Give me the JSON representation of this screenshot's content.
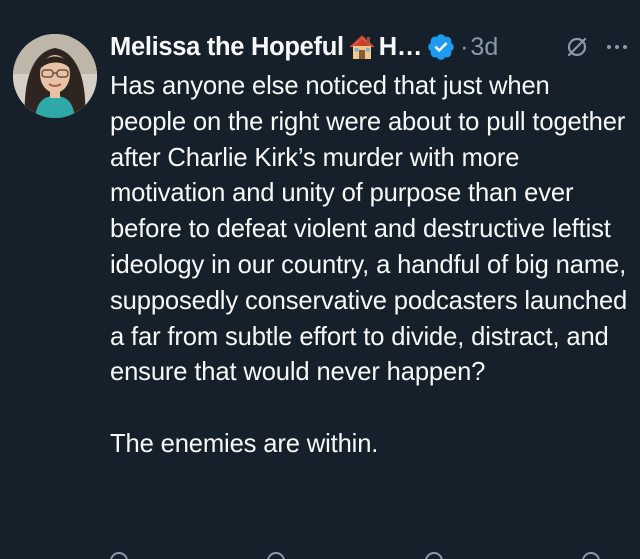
{
  "post": {
    "author": {
      "display_name": "Melissa the Hopeful",
      "name_truncation": "H…",
      "avatar_icon": "profile-photo",
      "emoji_icon": "house-icon",
      "verified_icon": "verified-badge-icon",
      "verified_color": "#1d9bf0"
    },
    "separator": "·",
    "timestamp": "3d",
    "header_icons": [
      "grok-icon",
      "more-icon"
    ],
    "body_paragraphs": [
      "Has anyone else noticed that just when people on the right were about to pull together after Charlie Kirk’s murder with more motivation and unity of purpose than ever before to defeat violent and destructive leftist ideology in our country, a handful of big name, supposedly conservative podcasters launched a far from subtle effort to divide, distract, and ensure that would never happen?",
      "The enemies are within."
    ]
  },
  "colors": {
    "background": "#15202b",
    "primary_text": "#f7f9f9",
    "secondary_text": "#8b98a5"
  }
}
